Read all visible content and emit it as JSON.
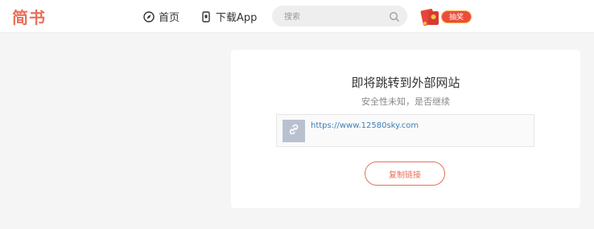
{
  "header": {
    "logo": "简书",
    "nav": {
      "home": "首页",
      "download_app": "下载App"
    },
    "search": {
      "placeholder": "搜索"
    },
    "promo": {
      "label": "抽奖"
    }
  },
  "card": {
    "title": "即将跳转到外部网站",
    "subtitle": "安全性未知，是否继续",
    "url": "https://www.12580sky.com",
    "copy_button": "复制链接"
  },
  "colors": {
    "brand": "#ea6f5a",
    "link": "#3f7fb8",
    "page_bg": "#f5f5f5",
    "promo_red": "#ec4c3c"
  },
  "icons": [
    "compass-icon",
    "phone-icon",
    "search-icon",
    "red-envelope-icon",
    "link-icon"
  ]
}
